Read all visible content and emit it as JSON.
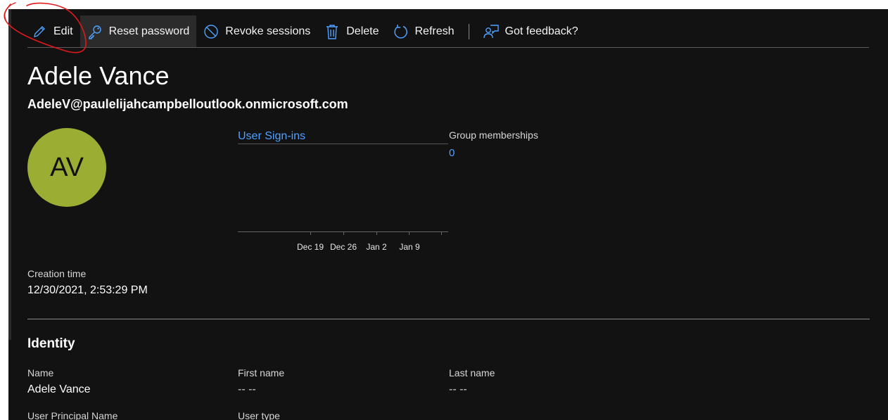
{
  "toolbar": {
    "items": [
      {
        "label": "Edit",
        "icon": "pencil-icon"
      },
      {
        "label": "Reset password",
        "icon": "key-icon"
      },
      {
        "label": "Revoke sessions",
        "icon": "block-icon"
      },
      {
        "label": "Delete",
        "icon": "trash-icon"
      },
      {
        "label": "Refresh",
        "icon": "refresh-icon"
      },
      {
        "label": "Got feedback?",
        "icon": "feedback-icon"
      }
    ]
  },
  "user": {
    "name": "Adele Vance",
    "email": "AdeleV@paulelijahcampbelloutlook.onmicrosoft.com",
    "initials": "AV",
    "avatar_color": "#9bae33"
  },
  "signins": {
    "title": "User Sign-ins",
    "ticks": [
      "Dec 19",
      "Dec 26",
      "Jan 2",
      "Jan 9"
    ]
  },
  "groups": {
    "label": "Group memberships",
    "value": "0"
  },
  "creation": {
    "label": "Creation time",
    "value": "12/30/2021, 2:53:29 PM"
  },
  "identity": {
    "title": "Identity",
    "fields": {
      "name_label": "Name",
      "name_value": "Adele Vance",
      "first_label": "First name",
      "first_value": "-- --",
      "last_label": "Last name",
      "last_value": "-- --",
      "upn_label": "User Principal Name",
      "type_label": "User type"
    }
  },
  "colors": {
    "background": "#121212",
    "link": "#4ea1ff",
    "annotation": "#e0191b"
  }
}
